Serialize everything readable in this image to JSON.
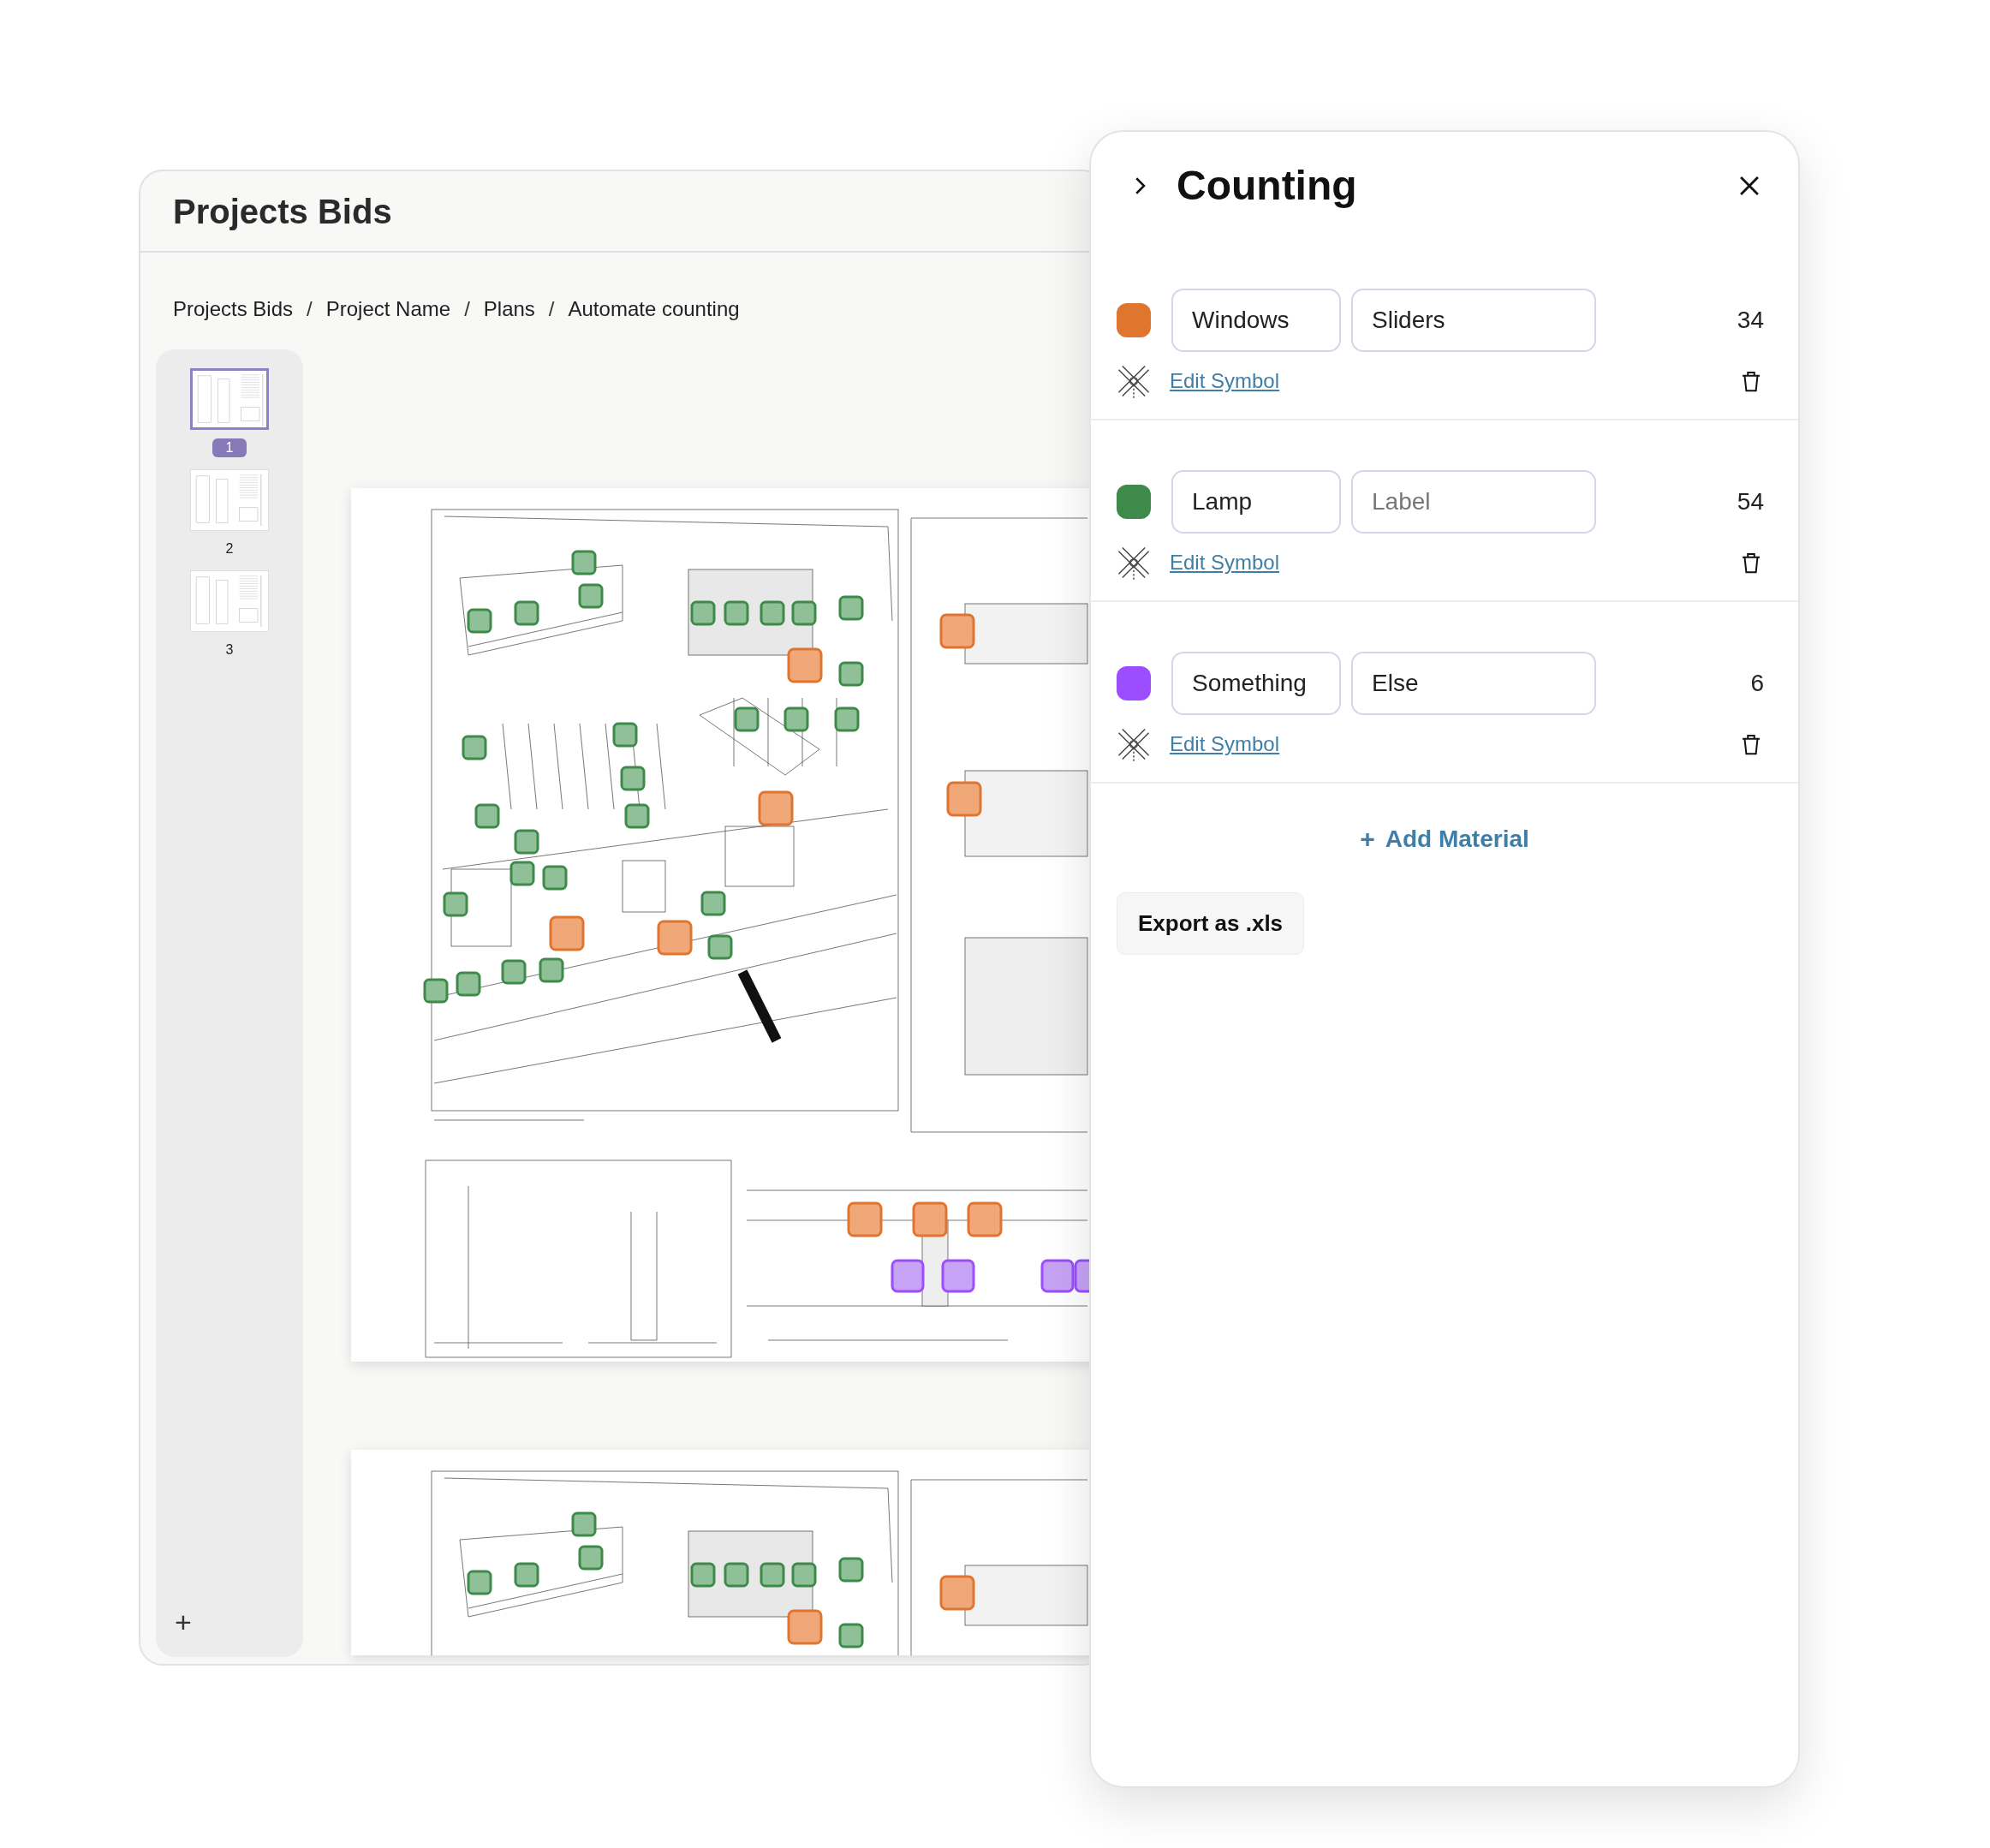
{
  "app": {
    "title": "Projects Bids",
    "breadcrumb": [
      "Projects Bids",
      "Project Name",
      "Plans",
      "Automate counting"
    ],
    "breadcrumb_separator": "/",
    "pages": [
      {
        "label": "1",
        "selected": true
      },
      {
        "label": "2",
        "selected": false
      },
      {
        "label": "3",
        "selected": false
      }
    ],
    "add_page_button": "+"
  },
  "panel": {
    "title": "Counting",
    "materials": [
      {
        "color": "#e07530",
        "name": "Windows",
        "label": {
          "value": "Sliders"
        },
        "count": "34",
        "link": "Edit Symbol"
      },
      {
        "color": "#3e8a4a",
        "name": "Lamp",
        "label": {
          "placeholder": "Label"
        },
        "count": "54",
        "link": "Edit Symbol"
      },
      {
        "color": "#9b4dff",
        "name": "Something",
        "label": {
          "value": "Else"
        },
        "count": "6",
        "link": "Edit Symbol"
      }
    ],
    "add_button": {
      "icon": "+",
      "label": "Add Material"
    },
    "export_button": "Export as .xls"
  }
}
